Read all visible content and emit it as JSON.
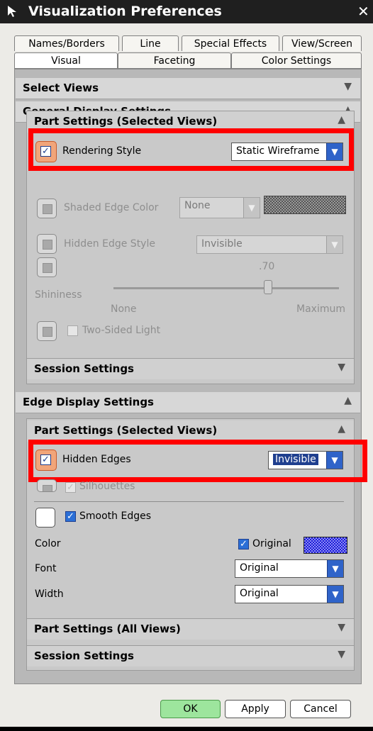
{
  "window": {
    "title": "Visualization Preferences",
    "close_glyph": "✕",
    "icon": "cursor-arrow-icon"
  },
  "tabs": {
    "row1": [
      "Names/Borders",
      "Line",
      "Special Effects",
      "View/Screen"
    ],
    "row2": [
      "Visual",
      "Faceting",
      "Color Settings"
    ],
    "active": "Visual"
  },
  "sections": {
    "select_views": "Select Views",
    "general_display": "General Display Settings",
    "edge_display": "Edge Display Settings"
  },
  "general": {
    "part_settings_title": "Part Settings (Selected Views)",
    "rendering_style_label": "Rendering Style",
    "rendering_style_value": "Static Wireframe",
    "shaded_edge_color_label": "Shaded Edge Color",
    "shaded_edge_color_value": "None",
    "hidden_edge_style_label": "Hidden Edge Style",
    "hidden_edge_style_value": "Invisible",
    "shininess_label": "Shininess",
    "shininess_value": ".70",
    "shininess_min": "None",
    "shininess_max": "Maximum",
    "two_sided_light_label": "Two-Sided Light",
    "session_settings_title": "Session Settings"
  },
  "edge": {
    "part_settings_title": "Part Settings (Selected Views)",
    "hidden_edges_label": "Hidden Edges",
    "hidden_edges_value": "Invisible",
    "silhouettes_label": "Silhouettes",
    "smooth_edges_label": "Smooth Edges",
    "color_label": "Color",
    "color_original_label": "Original",
    "font_label": "Font",
    "font_value": "Original",
    "width_label": "Width",
    "width_value": "Original",
    "part_settings_all_title": "Part Settings (All Views)",
    "session_settings_title": "Session Settings"
  },
  "buttons": {
    "ok": "OK",
    "apply": "Apply",
    "cancel": "Cancel"
  },
  "colors": {
    "highlight_red": "#ff0000",
    "ok_green": "#9de59d",
    "dropdown_blue": "#2f63c9"
  }
}
